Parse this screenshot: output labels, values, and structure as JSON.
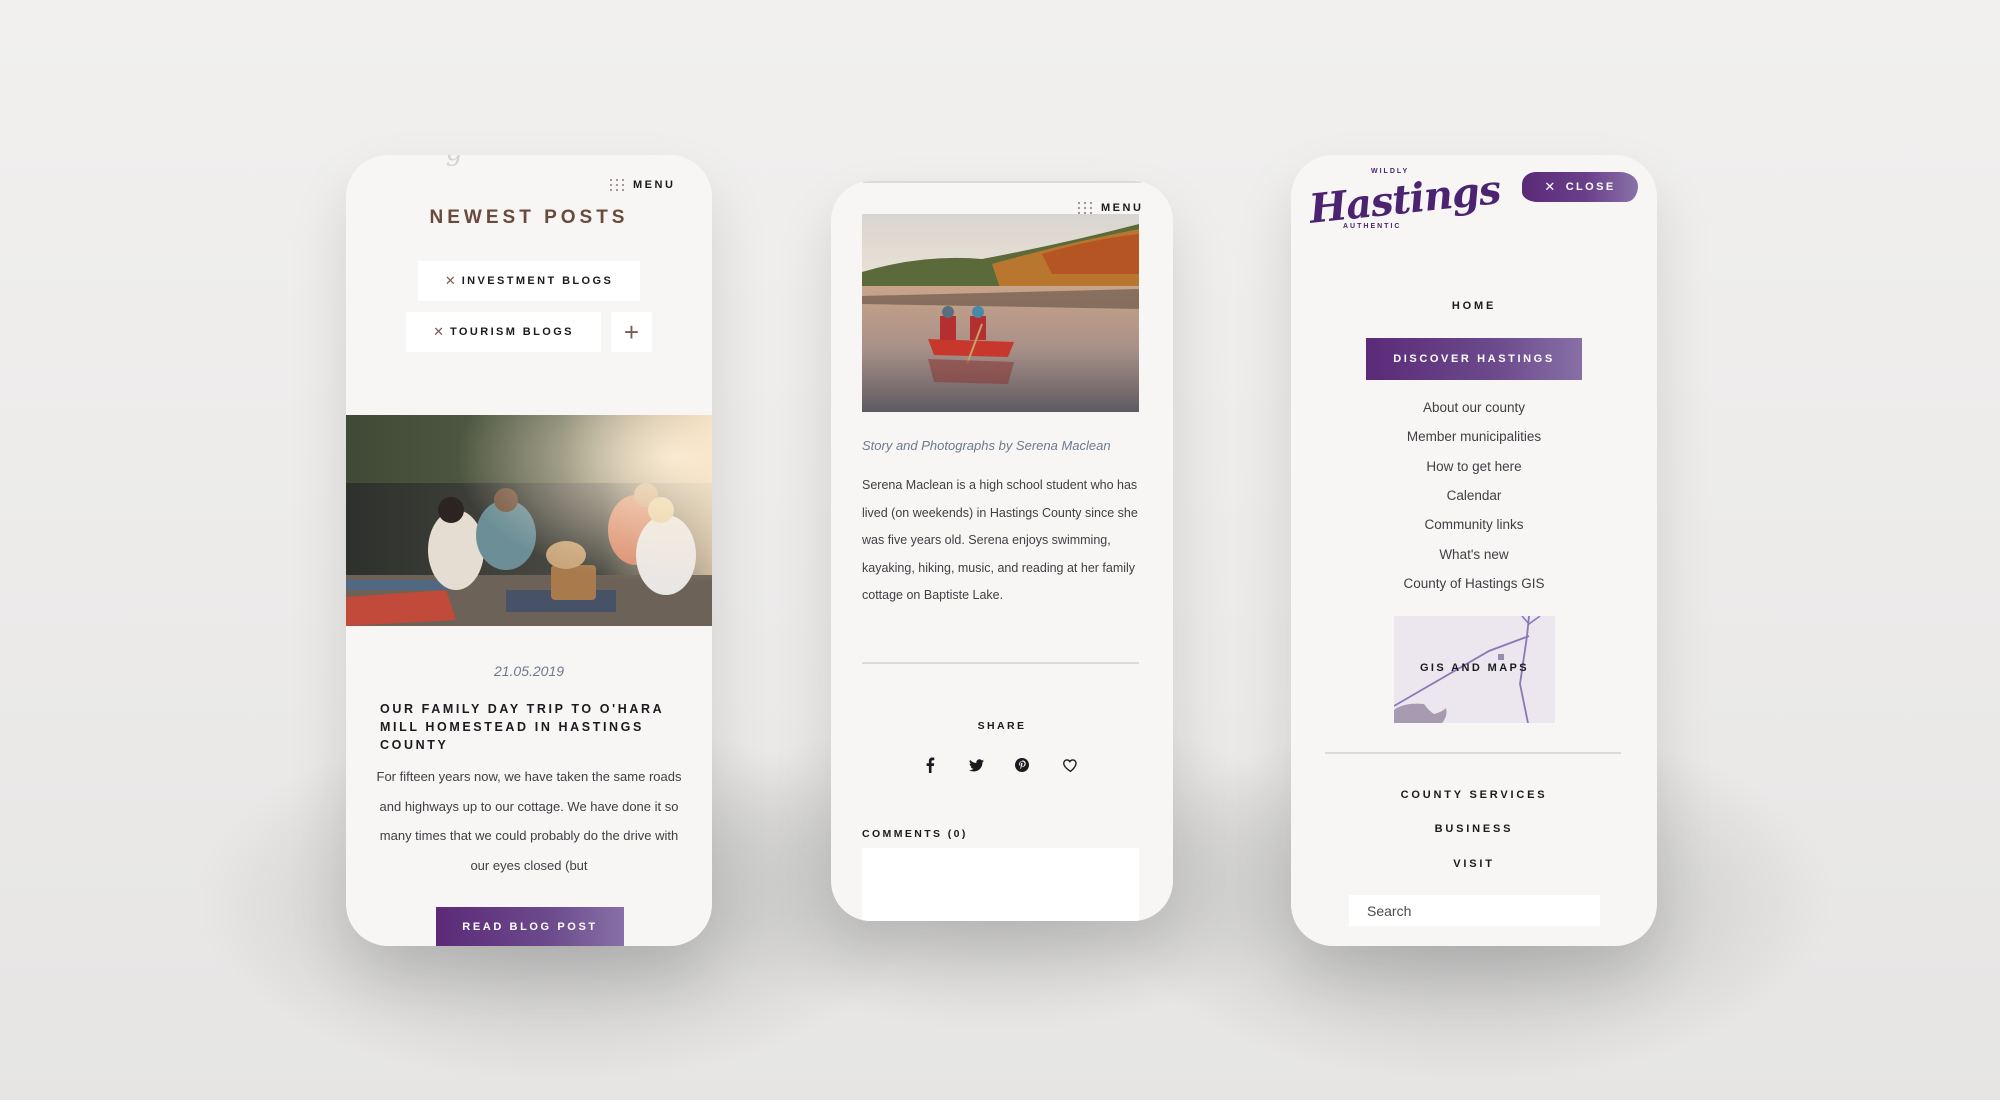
{
  "colors": {
    "accent_purple": "#5b2a78",
    "accent_purple_light": "#8770a6",
    "heading_brown": "#6a4a3c",
    "date_slate": "#6c7b8e",
    "card_bg": "#f7f6f4",
    "text_dark": "#1b1b1f"
  },
  "phone_blog_list": {
    "menu_icon": "grid-dots-icon",
    "menu_label": "MENU",
    "section_title": "NEWEST POSTS",
    "filters": [
      {
        "icon": "close-icon",
        "label": "INVESTMENT BLOGS"
      },
      {
        "icon": "close-icon",
        "label": "TOURISM BLOGS"
      }
    ],
    "add_filter_icon": "plus-icon",
    "post": {
      "image_alt": "Friends toasting on a lakeside dock picnic",
      "date": "21.05.2019",
      "title": "OUR FAMILY DAY TRIP TO O'HARA MILL HOMESTEAD IN HASTINGS COUNTY",
      "excerpt": "For fifteen years now, we have taken the same roads and highways up to our cottage. We have done it so many times that we could probably do the drive with our eyes closed (but",
      "button_label": "READ BLOG POST"
    }
  },
  "phone_article": {
    "menu_icon": "grid-dots-icon",
    "menu_label": "MENU",
    "image_alt": "Two people paddling a red canoe on an autumn lake",
    "caption": "Story and Photographs by Serena Maclean",
    "bio": "Serena Maclean is a high school student who has lived (on weekends) in Hastings County since she was five years old. Serena enjoys swimming, kayaking, hiking, music, and reading at her family cottage on Baptiste Lake.",
    "share_label": "SHARE",
    "share_icons": [
      "facebook-icon",
      "twitter-icon",
      "pinterest-icon",
      "heart-icon"
    ],
    "comments_label": "COMMENTS (0)"
  },
  "phone_menu": {
    "logo": {
      "top": "WILDLY",
      "main": "Hastings",
      "bottom": "AUTHENTIC"
    },
    "close_label": "CLOSE",
    "home_label": "HOME",
    "discover_label": "DISCOVER HASTINGS",
    "sub_links": [
      "About our county",
      "Member municipalities",
      "How to get here",
      "Calendar",
      "Community links",
      "What's new",
      "County of Hastings GIS"
    ],
    "map_tile_label": "GIS AND MAPS",
    "main_links": [
      "COUNTY SERVICES",
      "BUSINESS",
      "VISIT"
    ],
    "search_placeholder": "Search"
  }
}
